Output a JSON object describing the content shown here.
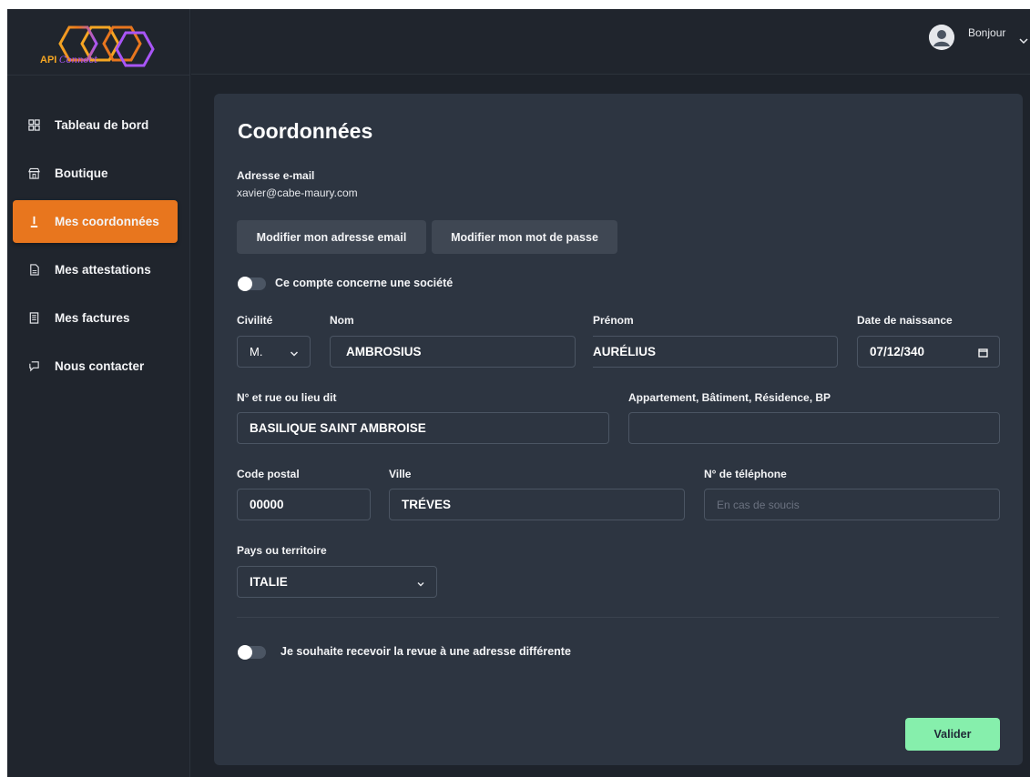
{
  "brand": {
    "logo_prefix": "API",
    "logo_suffix": "Connect"
  },
  "header": {
    "greeting": "Bonjour"
  },
  "sidebar": {
    "items": [
      {
        "label": "Tableau de bord",
        "icon": "dashboard-icon"
      },
      {
        "label": "Boutique",
        "icon": "shop-icon"
      },
      {
        "label": "Mes coordonnées",
        "icon": "user-icon",
        "active": true
      },
      {
        "label": "Mes attestations",
        "icon": "document-icon"
      },
      {
        "label": "Mes factures",
        "icon": "invoice-icon"
      },
      {
        "label": "Nous contacter",
        "icon": "chat-icon"
      }
    ]
  },
  "form": {
    "title": "Coordonnées",
    "email_label": "Adresse e-mail",
    "email_value": "xavier@cabe-maury.com",
    "change_email_button": "Modifier mon adresse email",
    "change_password_button": "Modifier mon mot de passe",
    "company_toggle_label": "Ce compte concerne une société",
    "company_toggle_on": false,
    "civility": {
      "label": "Civilité",
      "value": "M."
    },
    "last_name": {
      "label": "Nom",
      "value": "AMBROSIUS"
    },
    "first_name": {
      "label": "Prénom",
      "value": "AURÉLIUS"
    },
    "birth_date": {
      "label": "Date de naissance",
      "value": "07/12/340"
    },
    "street": {
      "label": "N° et rue ou lieu dit",
      "value": "BASILIQUE SAINT AMBROISE"
    },
    "apartment": {
      "label": "Appartement, Bâtiment, Résidence, BP",
      "value": ""
    },
    "postal_code": {
      "label": "Code postal",
      "value": "00000"
    },
    "city": {
      "label": "Ville",
      "value": "TRÉVES"
    },
    "phone": {
      "label": "N° de téléphone",
      "value": "",
      "placeholder": "En cas de soucis"
    },
    "country": {
      "label": "Pays ou territoire",
      "value": "ITALIE"
    },
    "different_address_toggle_label": "Je souhaite recevoir la revue à une adresse différente",
    "different_address_toggle_on": false,
    "submit_button": "Valider"
  },
  "colors": {
    "accent": "#e8761e",
    "submit": "#86efac",
    "card": "#2d3541",
    "background": "#1e232b"
  }
}
